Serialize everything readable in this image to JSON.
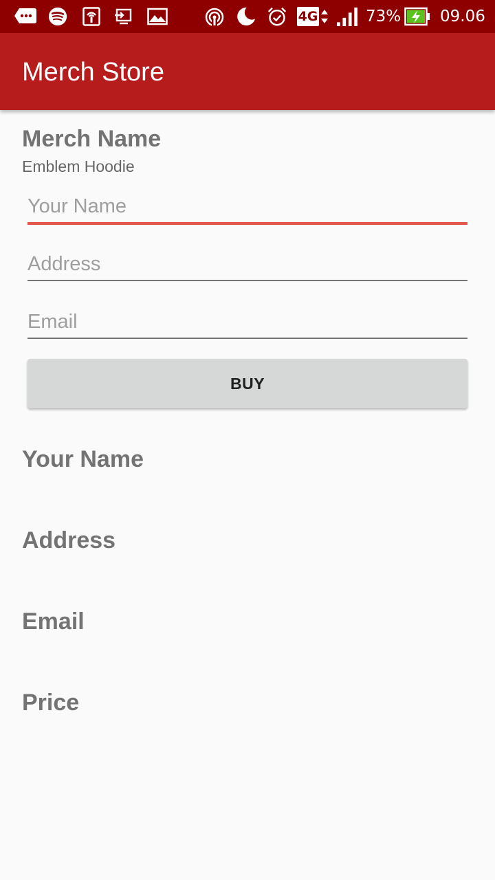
{
  "status_bar": {
    "icons": [
      "messenger-icon",
      "spotify-icon",
      "hotspot-icon",
      "cast-icon",
      "gallery-icon",
      "wireless-icon",
      "night-mode-icon",
      "alarm-icon",
      "network-4g-icon",
      "signal-icon",
      "battery-charging-icon"
    ],
    "network_label": "4G",
    "battery_percent": "73%",
    "time": "09.06"
  },
  "app_bar": {
    "title": "Merch Store",
    "color": "#b71c1c"
  },
  "merch": {
    "heading": "Merch Name",
    "name": "Emblem Hoodie"
  },
  "form": {
    "name_placeholder": "Your Name",
    "address_placeholder": "Address",
    "email_placeholder": "Email",
    "name_value": "",
    "address_value": "",
    "email_value": "",
    "buy_label": "BUY",
    "focus_color": "#e0574a"
  },
  "summary": {
    "name_label": "Your Name",
    "address_label": "Address",
    "email_label": "Email",
    "price_label": "Price"
  }
}
